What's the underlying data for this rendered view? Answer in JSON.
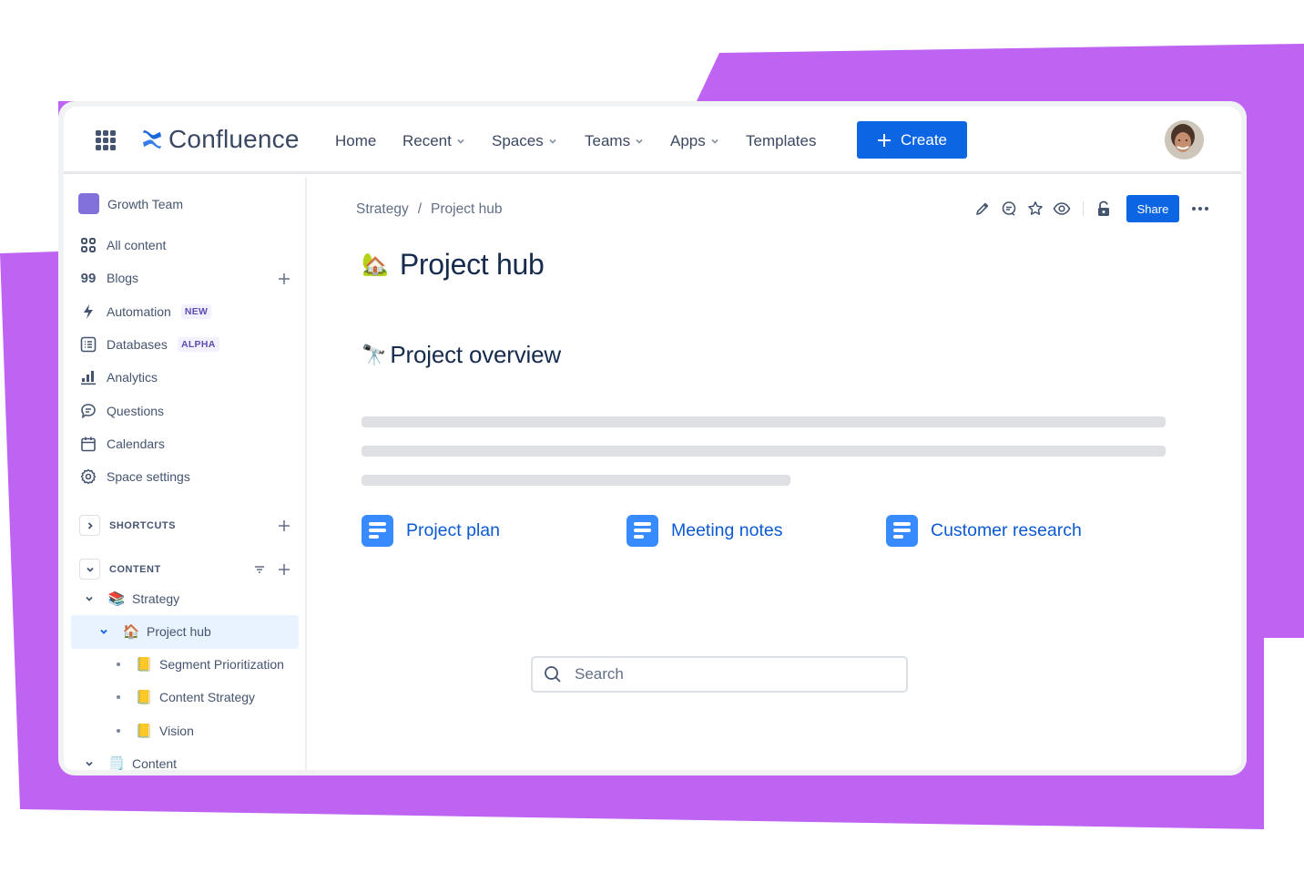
{
  "colors": {
    "backdrop_purple": "#bf63f3",
    "primary_blue": "#0c66e4",
    "link_blue": "#0c5ad3",
    "doc_icon_blue": "#388bff",
    "space_avatar": "#8270db",
    "selected_bg": "#e9f2ff",
    "badge_text": "#5e4db2",
    "badge_bg": "#f3f0ff"
  },
  "topnav": {
    "app_switcher_icon": "grid-icon",
    "logo_icon": "confluence-logo",
    "logo_text": "Confluence",
    "items": [
      {
        "label": "Home",
        "has_dropdown": false
      },
      {
        "label": "Recent",
        "has_dropdown": true
      },
      {
        "label": "Spaces",
        "has_dropdown": true
      },
      {
        "label": "Teams",
        "has_dropdown": true
      },
      {
        "label": "Apps",
        "has_dropdown": true
      },
      {
        "label": "Templates",
        "has_dropdown": false
      }
    ],
    "create_label": "Create",
    "avatar_icon": "user-avatar"
  },
  "sidebar": {
    "space_name": "Growth Team",
    "items": [
      {
        "label": "All content",
        "icon": "grid-squares-icon"
      },
      {
        "label": "Blogs",
        "icon": "quote-icon",
        "action": "plus"
      },
      {
        "label": "Automation",
        "icon": "lightning-icon",
        "badge": "NEW"
      },
      {
        "label": "Databases",
        "icon": "database-icon",
        "badge": "ALPHA"
      },
      {
        "label": "Analytics",
        "icon": "bar-chart-icon"
      },
      {
        "label": "Questions",
        "icon": "speech-bubble-icon"
      },
      {
        "label": "Calendars",
        "icon": "calendar-icon"
      },
      {
        "label": "Space settings",
        "icon": "gear-icon"
      }
    ],
    "shortcuts": {
      "label": "SHORTCUTS",
      "expanded": false
    },
    "content": {
      "label": "CONTENT",
      "expanded": true
    },
    "tree": [
      {
        "label": "Strategy",
        "emoji": "📚",
        "level": 0,
        "expanded": true
      },
      {
        "label": "Project hub",
        "emoji": "🏠",
        "level": 1,
        "expanded": true,
        "selected": true
      },
      {
        "label": "Segment Prioritization",
        "emoji": "📒",
        "level": 2
      },
      {
        "label": "Content Strategy",
        "emoji": "📒",
        "level": 2
      },
      {
        "label": "Vision",
        "emoji": "📒",
        "level": 2
      },
      {
        "label": "Content",
        "emoji": "🗒️",
        "level": 0,
        "expanded": true
      }
    ]
  },
  "main": {
    "breadcrumb": [
      "Strategy",
      "Project hub"
    ],
    "breadcrumb_sep": "/",
    "actions": {
      "icons": [
        "pencil-icon",
        "comment-icon",
        "star-icon",
        "eye-icon",
        "unlock-icon"
      ],
      "share_label": "Share",
      "more_icon": "ellipsis-icon"
    },
    "title_emoji": "🏡",
    "title": "Project hub",
    "section_emoji": "🔭",
    "section_title": "Project overview",
    "links": [
      {
        "label": "Project plan",
        "icon": "document-icon"
      },
      {
        "label": "Meeting notes",
        "icon": "document-icon"
      },
      {
        "label": "Customer research",
        "icon": "document-icon"
      }
    ],
    "search_placeholder": "Search"
  }
}
